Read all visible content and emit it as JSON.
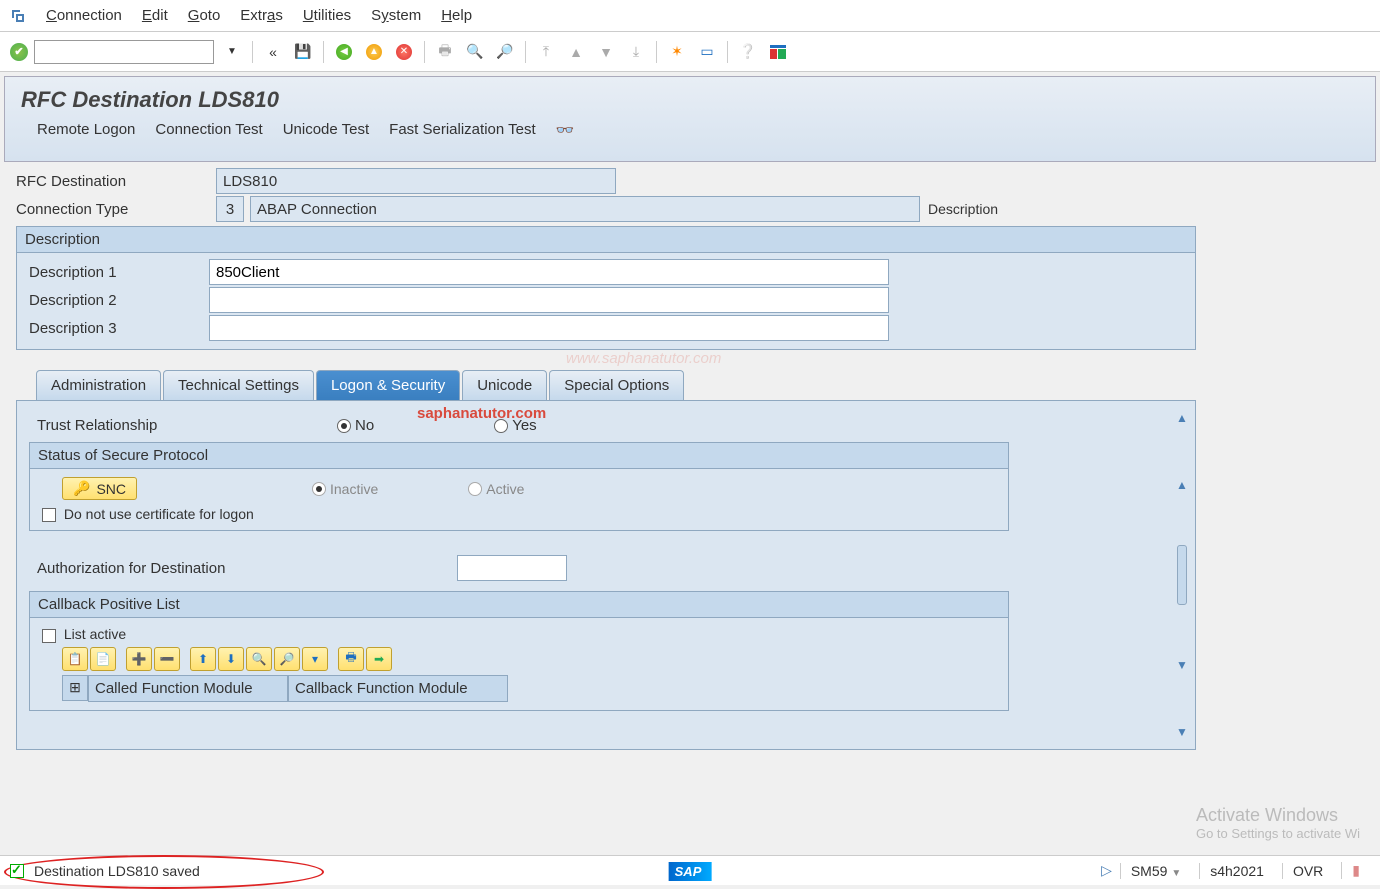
{
  "menu": {
    "items": [
      "Connection",
      "Edit",
      "Goto",
      "Extras",
      "Utilities",
      "System",
      "Help"
    ]
  },
  "title": "RFC Destination LDS810",
  "actions": {
    "remote_logon": "Remote Logon",
    "connection_test": "Connection Test",
    "unicode_test": "Unicode Test",
    "fast_serial_test": "Fast Serialization Test"
  },
  "header_fields": {
    "rfc_dest_label": "RFC Destination",
    "rfc_dest_value": "LDS810",
    "conn_type_label": "Connection Type",
    "conn_type_code": "3",
    "conn_type_text": "ABAP Connection",
    "description_side_label": "Description"
  },
  "description_group": {
    "title": "Description",
    "d1_label": "Description 1",
    "d1_value": "850Client",
    "d2_label": "Description 2",
    "d2_value": "",
    "d3_label": "Description 3",
    "d3_value": ""
  },
  "tabs": {
    "administration": "Administration",
    "technical": "Technical Settings",
    "logon": "Logon & Security",
    "unicode": "Unicode",
    "special": "Special Options"
  },
  "watermark_text": "saphanatutor.com",
  "watermark_url": "www.saphanatutor.com",
  "logon_tab": {
    "trust_label": "Trust Relationship",
    "no_label": "No",
    "yes_label": "Yes",
    "status_group_title": "Status of Secure Protocol",
    "snc_label": "SNC",
    "inactive_label": "Inactive",
    "active_label": "Active",
    "no_cert_label": "Do not use certificate for logon",
    "auth_label": "Authorization for Destination",
    "auth_value": "",
    "callback_group_title": "Callback Positive List",
    "list_active_label": "List active",
    "grid_col1": "Called Function Module",
    "grid_col2": "Callback Function Module"
  },
  "status": {
    "message": "Destination LDS810 saved",
    "tx": "SM59",
    "system": "s4h2021",
    "mode": "OVR"
  },
  "activate": {
    "title": "Activate Windows",
    "sub": "Go to Settings to activate Wi"
  }
}
